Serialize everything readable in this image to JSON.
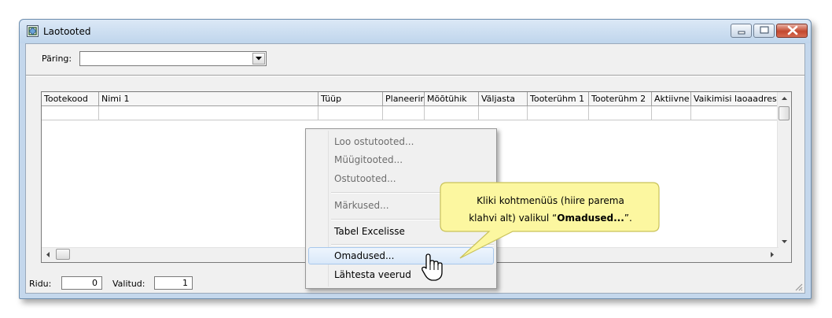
{
  "window": {
    "title": "Laotooted"
  },
  "query": {
    "label": "Päring:",
    "value": ""
  },
  "table": {
    "columns": [
      "Tootekood",
      "Nimi 1",
      "Tüüp",
      "Planeerim",
      "Mõõtühik",
      "Väljasta",
      "Tooterühm 1",
      "Tooterühm 2",
      "Aktiivne",
      "Vaikimisi laoaadress"
    ],
    "rows": [
      [
        "",
        "",
        "",
        "",
        "",
        "",
        "",
        "",
        "",
        ""
      ]
    ]
  },
  "status": {
    "rows_label": "Ridu:",
    "rows_value": "0",
    "selected_label": "Valitud:",
    "selected_value": "1"
  },
  "context_menu": {
    "items": [
      {
        "label": "Loo ostutooted...",
        "enabled": false
      },
      {
        "label": "Müügitooted...",
        "enabled": false
      },
      {
        "label": "Ostutooted...",
        "enabled": false
      },
      {
        "label": "Märkused...",
        "enabled": false
      },
      {
        "label": "Tabel Excelisse",
        "enabled": true
      },
      {
        "label": "Omadused...",
        "enabled": true,
        "highlighted": true
      },
      {
        "label": "Lähtesta veerud",
        "enabled": true
      }
    ]
  },
  "callout": {
    "line1": "Kliki kohtmenüüs (hiire parema",
    "line2_prefix": "klahvi alt) valikul “",
    "line2_bold": "Omadused...",
    "line2_suffix": "”."
  },
  "colors": {
    "window_frame": "#c4d7ec",
    "client_bg": "#f0f0f0",
    "callout_fill": "#fcf7a0",
    "callout_border": "#c9c25a",
    "menu_highlight": "#d9e8f9",
    "close_button": "#c3482f"
  },
  "icons": [
    "app-icon",
    "minimize-icon",
    "maximize-icon",
    "close-icon",
    "dropdown-arrow-icon",
    "hand-cursor-icon",
    "resize-grip-icon"
  ]
}
